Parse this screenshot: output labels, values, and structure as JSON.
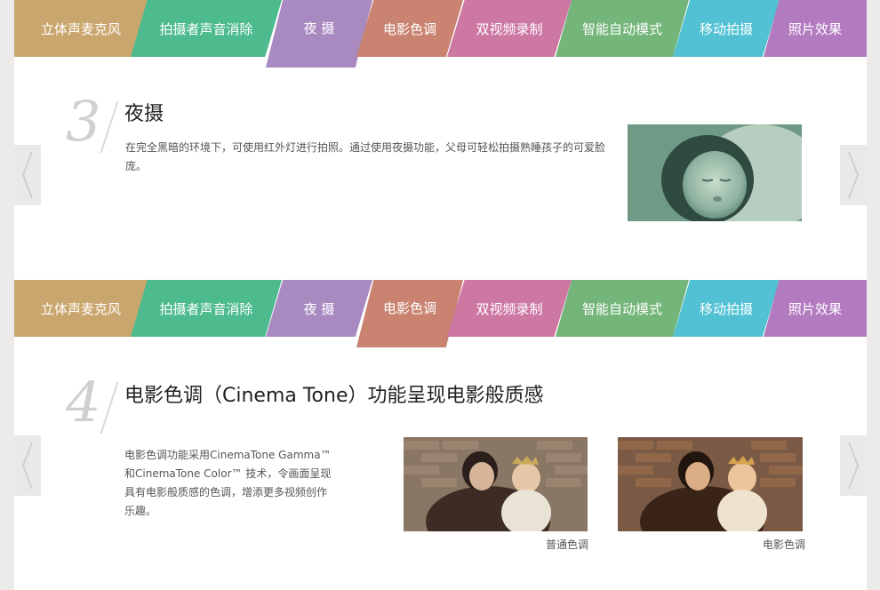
{
  "tabs": [
    {
      "label": "立体声麦克风",
      "color": "#c9a66e"
    },
    {
      "label": "拍摄者声音消除",
      "color": "#4ebb8e"
    },
    {
      "label": "夜  摄",
      "color": "#a98ac0"
    },
    {
      "label": "电影色调",
      "color": "#c98370"
    },
    {
      "label": "双视频录制",
      "color": "#cd77a3"
    },
    {
      "label": "智能自动模式",
      "color": "#74b57a"
    },
    {
      "label": "移动拍摄",
      "color": "#51c1d3"
    },
    {
      "label": "照片效果",
      "color": "#b37bbf"
    }
  ],
  "section3": {
    "number": "3",
    "title": "夜摄",
    "description": "在完全黑暗的环境下，可使用红外灯进行拍照。通过使用夜摄功能，父母可轻松拍摄熟睡孩子的可爱脸庞。"
  },
  "section4": {
    "number": "4",
    "title": "电影色调（Cinema Tone）功能呈现电影般质感",
    "description_line1": "电影色调功能采用CinemaTone Gamma™",
    "description_line2": "和CinemaTone Color™ 技术，令画面呈现",
    "description_line3": "具有电影般质感的色调，增添更多视频创作",
    "description_line4": "乐趣。",
    "caption_normal": "普通色调",
    "caption_cinema": "电影色调"
  },
  "arrows": {
    "prev": "‹",
    "next": "›"
  }
}
